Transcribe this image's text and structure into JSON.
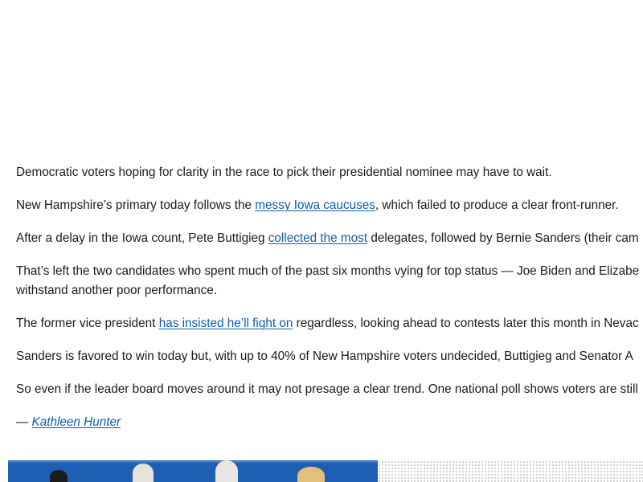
{
  "article": {
    "paragraphs": [
      {
        "segments": [
          {
            "text": "Democratic voters hoping for clarity in the race to pick their presidential nominee may have to wait."
          }
        ]
      },
      {
        "segments": [
          {
            "text": "New Hampshire’s primary today follows the "
          },
          {
            "text": "messy Iowa caucuses",
            "link": true
          },
          {
            "text": ", which failed to produce a clear front-runner."
          }
        ]
      },
      {
        "segments": [
          {
            "text": "After a delay in the Iowa count, Pete Buttigieg "
          },
          {
            "text": "collected the most",
            "link": true
          },
          {
            "text": " delegates, followed by Bernie Sanders (their cam"
          }
        ]
      },
      {
        "segments": [
          {
            "text": "That’s left the two candidates who spent much of the past six months vying for top status — Joe Biden and Elizabe withstand another poor performance."
          }
        ],
        "wrap": true
      },
      {
        "segments": [
          {
            "text": "The former vice president "
          },
          {
            "text": "has insisted he’ll fight on",
            "link": true
          },
          {
            "text": " regardless, looking ahead to contests later this month in Nevac"
          }
        ]
      },
      {
        "segments": [
          {
            "text": "Sanders is favored to win today but, with up to 40% of New Hampshire voters undecided, Buttigieg and Senator A"
          }
        ]
      },
      {
        "segments": [
          {
            "text": "So even if the leader board moves around it may not presage a clear trend. One national poll shows voters are still"
          }
        ]
      }
    ],
    "byline": {
      "dash": "— ",
      "author": "Kathleen Hunter"
    }
  },
  "colors": {
    "link": "#0f5da8",
    "photo_blue": "#1f5fb3"
  }
}
